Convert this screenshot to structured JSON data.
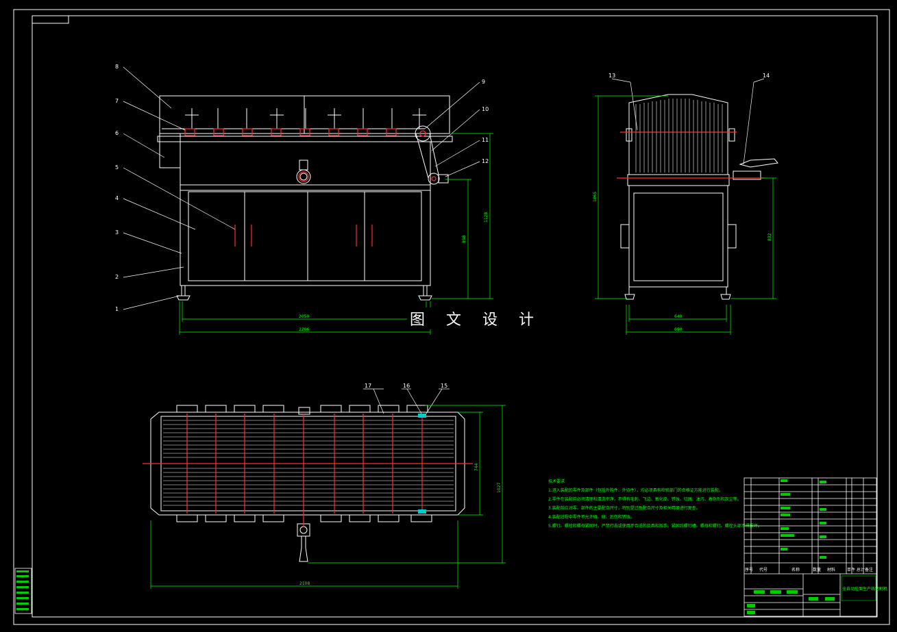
{
  "watermark": "图 文 设 计",
  "part_labels": {
    "front": [
      "1",
      "2",
      "3",
      "4",
      "5",
      "6",
      "7",
      "8",
      "9",
      "10",
      "11",
      "12"
    ],
    "side": [
      "13",
      "14"
    ],
    "top": [
      "17",
      "16",
      "15"
    ]
  },
  "dimensions": {
    "front_inner_width": "2050",
    "front_outer_width": "2206",
    "front_height_mid": "898",
    "front_height_top": "1128",
    "side_height_total": "1865",
    "side_height_right": "832",
    "side_width_inner": "640",
    "side_width_outer": "690",
    "top_width": "2108",
    "top_depth_inner": "744",
    "top_depth_outer": "1027"
  },
  "technical_requirements": {
    "title": "技术要求",
    "items": [
      "1.进入装配的零件及部件（包括外购件、外协件），均必须具有检验部门的合格证方能进行装配。",
      "2.零件在装配前必须清理和清洗干净，不得有毛刺、飞边、氧化皮、锈蚀、切屑、油污、着色剂和灰尘等。",
      "3.装配前应对零、部件的主要配合尺寸，特别是过盈配合尺寸及相关精度进行复查。",
      "4.装配过程中零件不允许磕、碰、划伤和锈蚀。",
      "5.螺钉、螺栓和螺母紧固时，严禁打击或使用不合适的旋具和扳手。紧固后螺钉槽、螺母和螺钉、螺栓头部不得损坏。"
    ]
  },
  "title_block": {
    "col_headers": [
      "序号",
      "代号",
      "名称",
      "数量",
      "材料",
      "单件 总计",
      "备注"
    ],
    "drawing_title": "全自动挂面生产线切割机"
  },
  "colors": {
    "background": "#000000",
    "lines": "#ffffff",
    "dimensions": "#00ff00",
    "accent": "#ff3030",
    "highlight": "#00cccc"
  }
}
